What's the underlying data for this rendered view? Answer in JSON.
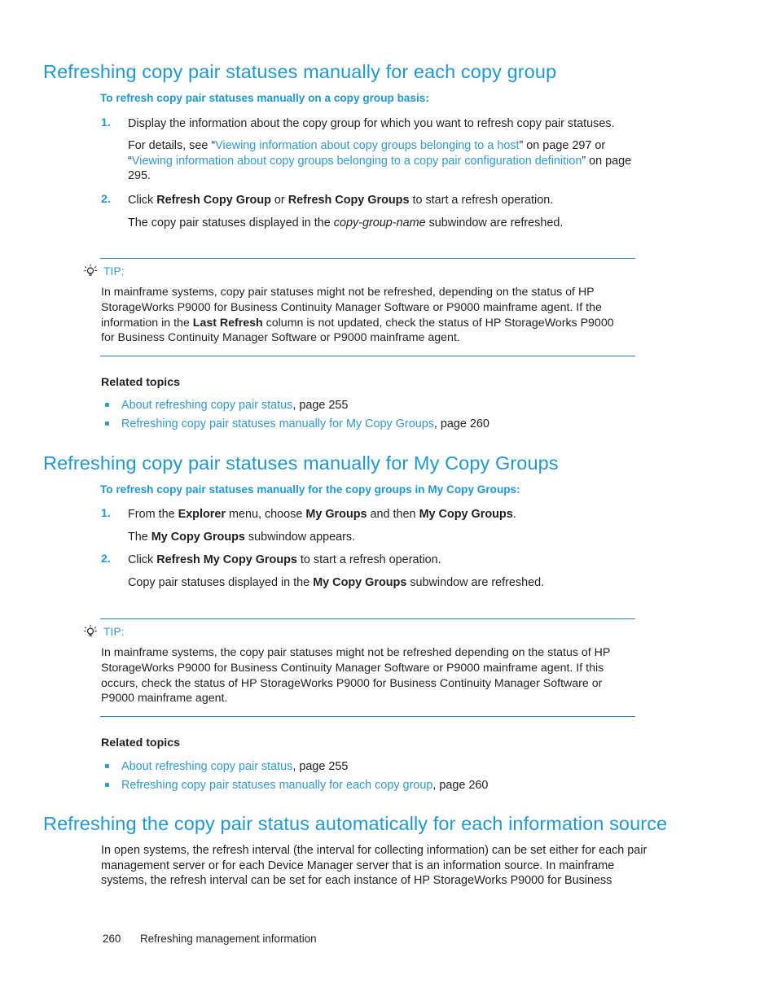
{
  "document": {
    "page_number": "260",
    "footer_title": "Refreshing management information"
  },
  "sections": [
    {
      "heading": "Refreshing copy pair statuses manually for each copy group",
      "subheading": "To refresh copy pair statuses manually on a copy group basis:",
      "steps": [
        {
          "number": "1.",
          "text": "Display the information about the copy group for which you want to refresh copy pair statuses.",
          "detail_prefix": "For details, see “",
          "detail_link1": "Viewing information about copy groups belonging to a host",
          "detail_mid": "” on page 297 or “",
          "detail_link2": "Viewing information about copy groups belonging to a copy pair configuration definition",
          "detail_suffix": "” on page 295."
        },
        {
          "number": "2.",
          "text_before": "Click ",
          "bold1": "Refresh Copy Group",
          "text_mid": " or ",
          "bold2": "Refresh Copy Groups",
          "text_after": " to start a refresh operation.",
          "result_before": "The copy pair statuses displayed in the ",
          "result_italic": "copy-group-name",
          "result_after": " subwindow are refreshed."
        }
      ],
      "tip": {
        "label": "TIP:",
        "icon": "lightbulb-icon",
        "text_part1": "In mainframe systems, copy pair statuses might not be refreshed, depending on the status of HP StorageWorks P9000 for Business Continuity Manager Software or P9000 mainframe agent. If the information in the ",
        "bold": "Last Refresh",
        "text_part2": " column is not updated, check the status of HP StorageWorks P9000 for Business Continuity Manager Software or P9000 mainframe agent."
      },
      "related": {
        "title": "Related topics",
        "items": [
          {
            "link": "About refreshing copy pair status",
            "page": ", page 255"
          },
          {
            "link": "Refreshing copy pair statuses manually for My Copy Groups",
            "page": ", page 260"
          }
        ]
      }
    },
    {
      "heading": "Refreshing copy pair statuses manually for My Copy Groups",
      "subheading": "To refresh copy pair statuses manually for the copy groups in My Copy Groups:",
      "steps": [
        {
          "number": "1.",
          "text_before": "From the ",
          "bold1": "Explorer",
          "text_mid": " menu, choose ",
          "bold2": "My Groups",
          "text_mid2": " and then ",
          "bold3": "My Copy Groups",
          "text_after": ".",
          "result_before": "The ",
          "result_bold": "My Copy Groups",
          "result_after": " subwindow appears."
        },
        {
          "number": "2.",
          "text_before": "Click ",
          "bold1": "Refresh My Copy Groups",
          "text_after": " to start a refresh operation.",
          "result_before": "Copy pair statuses displayed in the ",
          "result_bold": "My Copy Groups",
          "result_after": " subwindow are refreshed."
        }
      ],
      "tip": {
        "label": "TIP:",
        "icon": "lightbulb-icon",
        "text": "In mainframe systems, the copy pair statuses might not be refreshed depending on the status of HP StorageWorks P9000 for Business Continuity Manager Software or P9000 mainframe agent. If this occurs, check the status of HP StorageWorks P9000 for Business Continuity Manager Software or P9000 mainframe agent."
      },
      "related": {
        "title": "Related topics",
        "items": [
          {
            "link": "About refreshing copy pair status",
            "page": ", page 255"
          },
          {
            "link": "Refreshing copy pair statuses manually for each copy group",
            "page": ", page 260"
          }
        ]
      }
    },
    {
      "heading": "Refreshing the copy pair status automatically for each information source",
      "body": "In open systems, the refresh interval (the interval for collecting information) can be set either for each pair management server or for each Device Manager server that is an information source. In mainframe systems, the refresh interval can be set for each instance of HP StorageWorks P9000 for Business"
    }
  ],
  "colors": {
    "heading_blue": "#1C9AD6",
    "link_blue": "#2C9BD6",
    "rule_blue": "#1C87C4",
    "body_black": "#231F20"
  }
}
